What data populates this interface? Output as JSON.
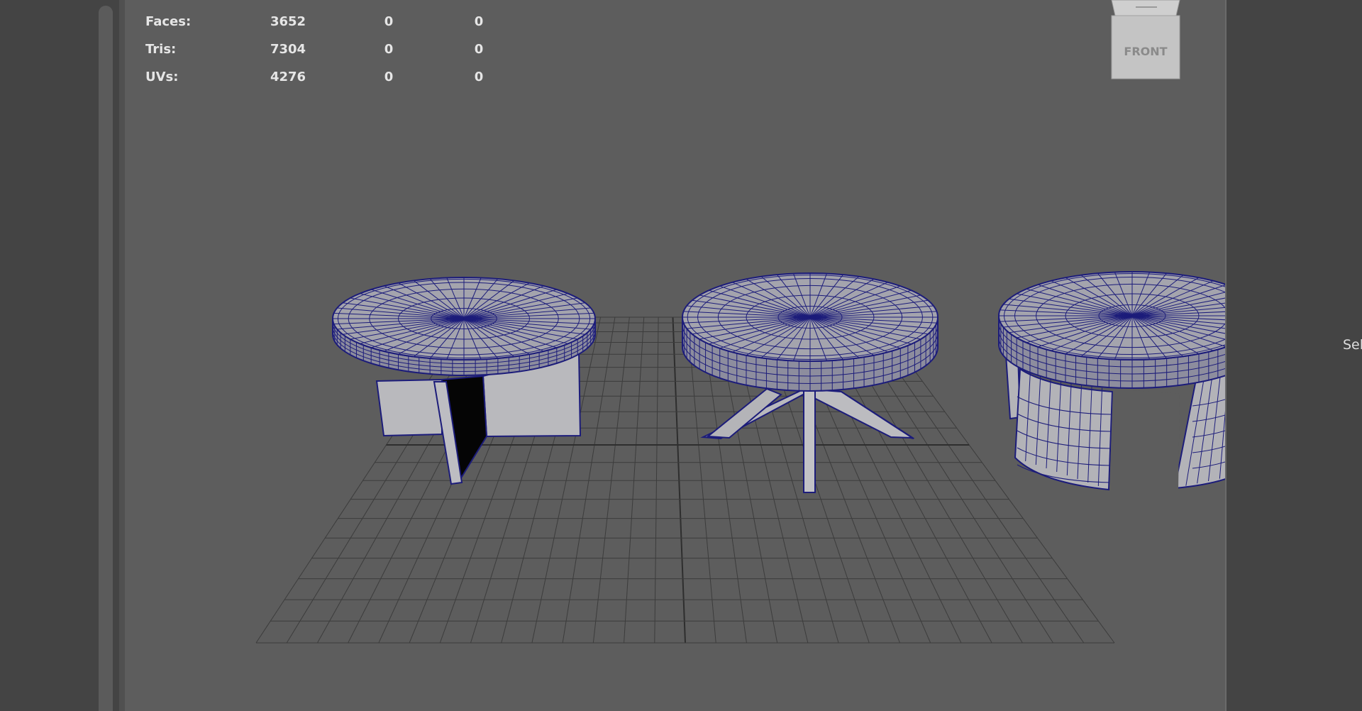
{
  "viewport": {
    "hud": {
      "rows": [
        {
          "label": "Faces:",
          "values": [
            "3652",
            "0",
            "0"
          ]
        },
        {
          "label": "Tris:",
          "values": [
            "7304",
            "0",
            "0"
          ]
        },
        {
          "label": "UVs:",
          "values": [
            "4276",
            "0",
            "0"
          ]
        }
      ]
    },
    "view_cube": {
      "face_label": "FRONT"
    },
    "wire_color": "#1c1c7a",
    "grid_color": "#3c3c3c",
    "background_color": "#5d5d5d"
  },
  "right_panel": {
    "partial_label": "Sel"
  }
}
